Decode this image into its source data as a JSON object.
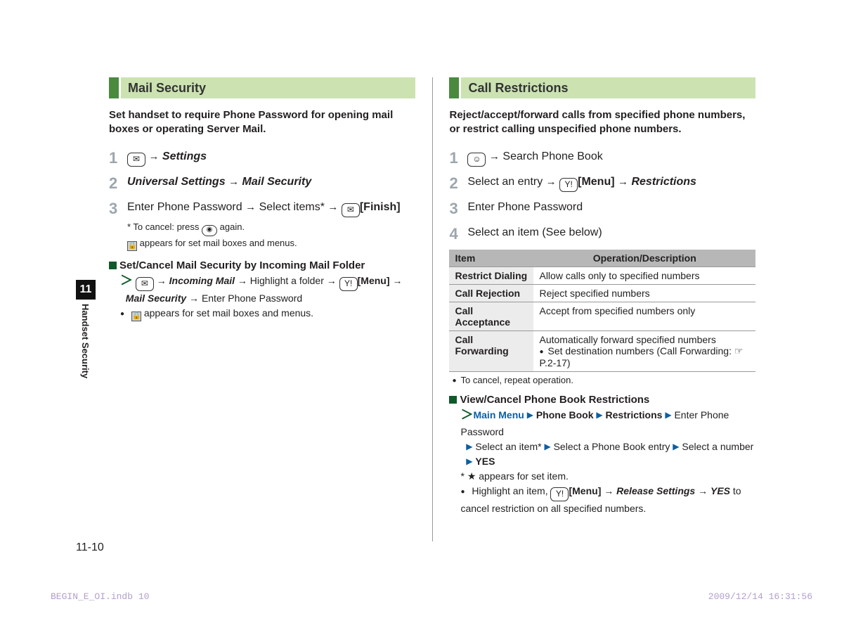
{
  "left": {
    "heading": "Mail Security",
    "intro": "Set handset to require Phone Password for opening mail boxes or operating Server Mail.",
    "steps": {
      "s1_key": "✉",
      "s1_arrow": "→",
      "s1_settings": "Settings",
      "s2_us": "Universal Settings",
      "s2_arrow": "→",
      "s2_ms": "Mail Security",
      "s3_a": "Enter Phone Password",
      "s3_b": "Select items*",
      "s3_key": "✉",
      "s3_finish": "[Finish]",
      "s3_note1": "* To cancel: press",
      "s3_note1b": "again.",
      "s3_note2": "appears for set mail boxes and menus."
    },
    "sub": {
      "head": "Set/Cancel Mail Security by Incoming Mail Folder",
      "l1_key": "✉",
      "l1_incoming": "Incoming Mail",
      "l1_high": "Highlight a folder",
      "l1_menukey": "Y!",
      "l1_menu": "[Menu]",
      "l2_ms": "Mail Security",
      "l2_enter": "Enter Phone Password",
      "l3": "appears for set mail boxes and menus."
    }
  },
  "right": {
    "heading": "Call Restrictions",
    "intro": "Reject/accept/forward calls from specified phone numbers, or restrict calling unspecified phone numbers.",
    "steps": {
      "s1_key": "☺",
      "s1_text": "Search Phone Book",
      "s2_a": "Select an entry",
      "s2_key": "Y!",
      "s2_menu": "[Menu]",
      "s2_rest": "Restrictions",
      "s3": "Enter Phone Password",
      "s4": "Select an item (See below)"
    },
    "table": {
      "h1": "Item",
      "h2": "Operation/Description",
      "r1a": "Restrict Dialing",
      "r1b": "Allow calls only to specified numbers",
      "r2a": "Call Rejection",
      "r2b": "Reject specified numbers",
      "r3a": "Call Acceptance",
      "r3b": "Accept from specified numbers only",
      "r4a": "Call Forwarding",
      "r4b": "Automatically forward specified numbers",
      "r4c": "Set destination numbers (Call Forwarding: ☞P.2-17)",
      "note": "To cancel, repeat operation."
    },
    "sub": {
      "head": "View/Cancel Phone Book Restrictions",
      "mm": "Main Menu",
      "pb": "Phone Book",
      "rs": "Restrictions",
      "epp": "Enter Phone Password",
      "sai": "Select an item*",
      "spe": "Select a Phone Book entry",
      "san": "Select a number",
      "yes": "YES",
      "star": "* ★ appears for set item.",
      "hl": "Highlight an item,",
      "menukey": "Y!",
      "menu": "[Menu]",
      "rel": "Release Settings",
      "yes2": "YES",
      "tail": "to cancel restriction on all specified numbers."
    }
  },
  "side": {
    "num": "11",
    "label": "Handset Security"
  },
  "page_num": "11-10",
  "footer_left": "BEGIN_E_OI.indb   10",
  "footer_right": "2009/12/14   16:31:56"
}
